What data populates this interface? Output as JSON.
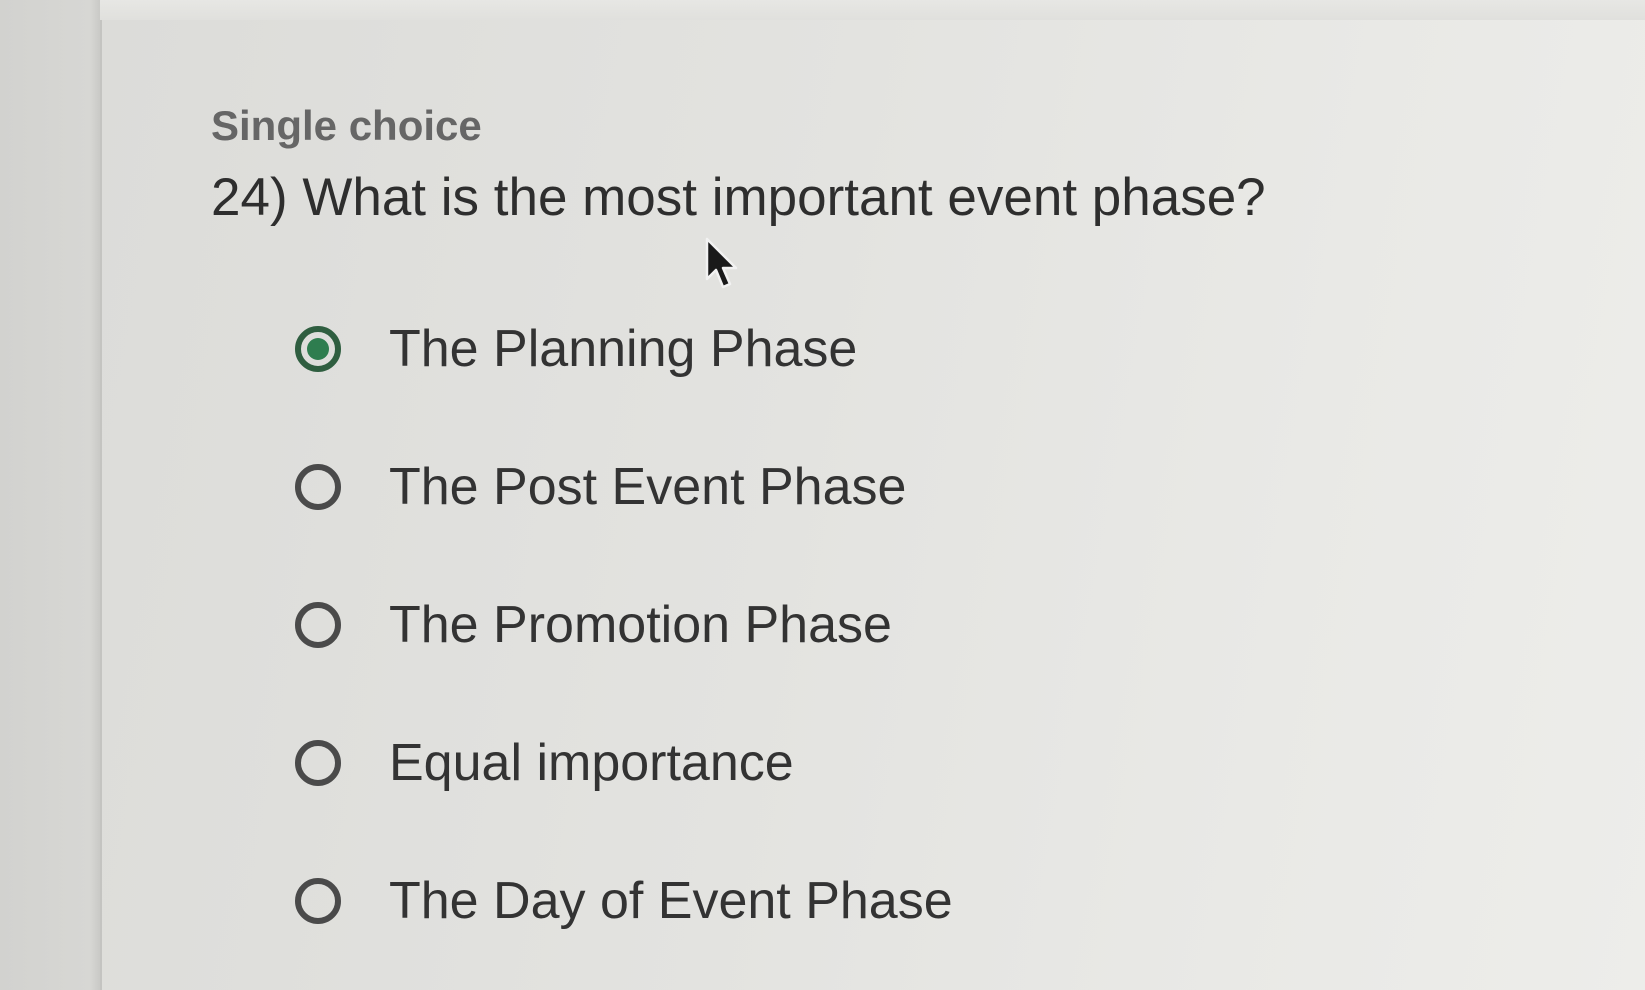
{
  "question": {
    "type_label": "Single choice",
    "text": "24) What is the most important event phase?"
  },
  "options": [
    {
      "label": "The Planning Phase",
      "selected": true
    },
    {
      "label": "The Post Event Phase",
      "selected": false
    },
    {
      "label": "The Promotion Phase",
      "selected": false
    },
    {
      "label": "Equal importance",
      "selected": false
    },
    {
      "label": "The Day of Event Phase",
      "selected": false
    }
  ],
  "colors": {
    "selected_radio": "#2e7d4f",
    "radio_border": "#4a4a4a",
    "background": "#e3e3e0"
  },
  "icons": {
    "cursor": "mouse-pointer-icon"
  }
}
